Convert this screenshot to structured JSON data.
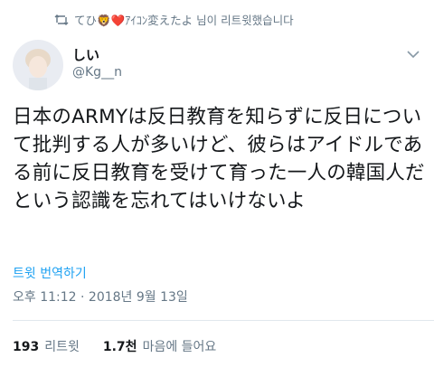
{
  "retweet_notice": {
    "text": "てひ🦁❤️ｱｲｺﾝ変えたよ 님이 리트윗했습니다"
  },
  "author": {
    "name": "しい",
    "handle": "@Kg__n"
  },
  "tweet": {
    "text": "日本のARMYは反日教育を知らずに反日について批判する人が多いけど、彼らはアイドルである前に反日教育を受けて育った一人の韓国人だという認識を忘れてはいけないよ",
    "translate_label": "트윗 번역하기",
    "timestamp": "오후 11:12 · 2018년 9월 13일"
  },
  "stats": {
    "retweets_count": "193",
    "retweets_label": "리트윗",
    "likes_count": "1.7천",
    "likes_label": "마음에 들어요"
  },
  "icons": {
    "retweet": "retweet-icon",
    "menu": "chevron-down-icon",
    "avatar": "avatar"
  },
  "colors": {
    "accent": "#1da1f2",
    "muted": "#657786"
  }
}
